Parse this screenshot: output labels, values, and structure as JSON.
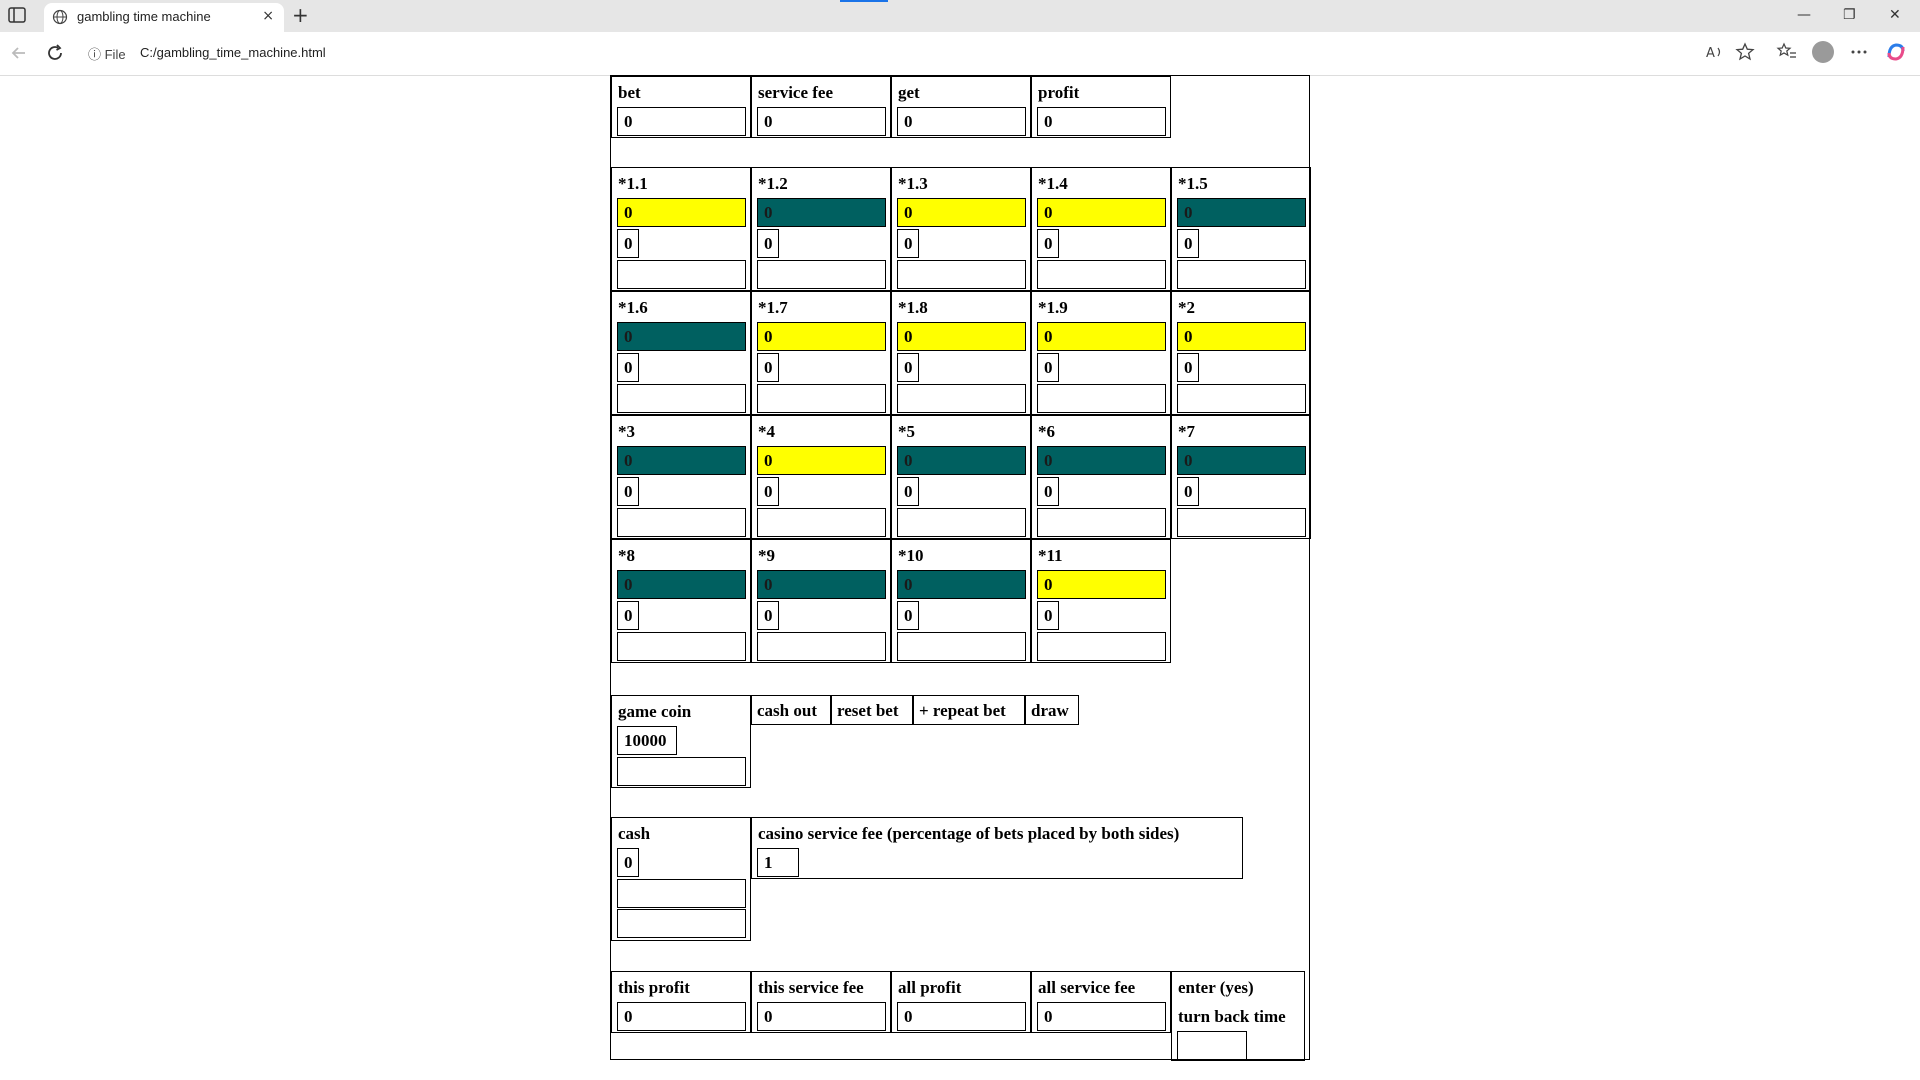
{
  "browser": {
    "tab_title": "gambling time machine",
    "tab_close": "×",
    "new_tab": "+",
    "address_info": "ⓘ File",
    "url": "C:/gambling_time_machine.html",
    "win_minimize": "—",
    "win_restore": "❐",
    "win_close": "✕"
  },
  "summary": [
    {
      "label": "bet",
      "value": "0"
    },
    {
      "label": "service fee",
      "value": "0"
    },
    {
      "label": "get",
      "value": "0"
    },
    {
      "label": "profit",
      "value": "0"
    }
  ],
  "multipliers": [
    {
      "label": "*1.1",
      "value": "0",
      "bet": "0",
      "color": "yellow"
    },
    {
      "label": "*1.2",
      "value": "0",
      "bet": "0",
      "color": "teal"
    },
    {
      "label": "*1.3",
      "value": "0",
      "bet": "0",
      "color": "yellow"
    },
    {
      "label": "*1.4",
      "value": "0",
      "bet": "0",
      "color": "yellow"
    },
    {
      "label": "*1.5",
      "value": "0",
      "bet": "0",
      "color": "teal"
    },
    {
      "label": "*1.6",
      "value": "0",
      "bet": "0",
      "color": "teal"
    },
    {
      "label": "*1.7",
      "value": "0",
      "bet": "0",
      "color": "yellow"
    },
    {
      "label": "*1.8",
      "value": "0",
      "bet": "0",
      "color": "yellow"
    },
    {
      "label": "*1.9",
      "value": "0",
      "bet": "0",
      "color": "yellow"
    },
    {
      "label": "*2",
      "value": "0",
      "bet": "0",
      "color": "yellow"
    },
    {
      "label": "*3",
      "value": "0",
      "bet": "0",
      "color": "teal"
    },
    {
      "label": "*4",
      "value": "0",
      "bet": "0",
      "color": "yellow"
    },
    {
      "label": "*5",
      "value": "0",
      "bet": "0",
      "color": "teal"
    },
    {
      "label": "*6",
      "value": "0",
      "bet": "0",
      "color": "teal"
    },
    {
      "label": "*7",
      "value": "0",
      "bet": "0",
      "color": "teal"
    },
    {
      "label": "*8",
      "value": "0",
      "bet": "0",
      "color": "teal"
    },
    {
      "label": "*9",
      "value": "0",
      "bet": "0",
      "color": "teal"
    },
    {
      "label": "*10",
      "value": "0",
      "bet": "0",
      "color": "teal"
    },
    {
      "label": "*11",
      "value": "0",
      "bet": "0",
      "color": "yellow"
    }
  ],
  "colors": {
    "yellow": "#ffff00",
    "teal": "#006060"
  },
  "game_coin": {
    "label": "game coin",
    "value": "10000"
  },
  "buttons": {
    "cash_out": "cash out",
    "reset_bet": "reset bet",
    "repeat_bet": "+ repeat bet",
    "draw": "draw"
  },
  "cash": {
    "label": "cash",
    "value": "0"
  },
  "casino_fee": {
    "label": "casino service fee (percentage of bets placed by both sides)",
    "value": "1"
  },
  "stats": [
    {
      "label": "this profit",
      "value": "0"
    },
    {
      "label": "this service fee",
      "value": "0"
    },
    {
      "label": "all profit",
      "value": "0"
    },
    {
      "label": "all service fee",
      "value": "0"
    }
  ],
  "time_machine": {
    "label1": "enter (yes)",
    "label2": "turn back time"
  }
}
